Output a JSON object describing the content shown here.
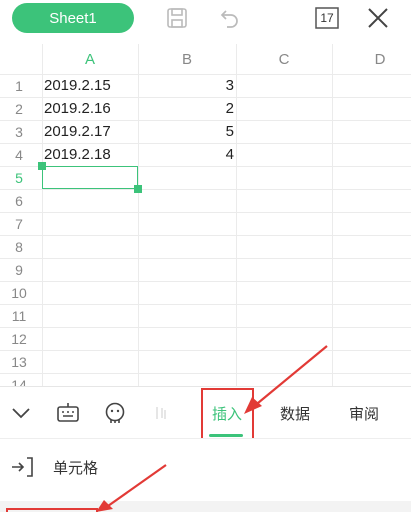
{
  "header": {
    "sheet_tab": "Sheet1",
    "page_count": "17"
  },
  "grid": {
    "columns": [
      "A",
      "B",
      "C",
      "D"
    ],
    "rows": [
      "1",
      "2",
      "3",
      "4",
      "5",
      "6",
      "7",
      "8",
      "9",
      "10",
      "11",
      "12",
      "13",
      "14"
    ],
    "cells": [
      {
        "a": "2019.2.15",
        "b": "3"
      },
      {
        "a": "2019.2.16",
        "b": "2"
      },
      {
        "a": "2019.2.17",
        "b": "5"
      },
      {
        "a": "2019.2.18",
        "b": "4"
      }
    ],
    "active_cell": "A5"
  },
  "toolbar": {
    "tabs": [
      "插入",
      "数据",
      "审阅"
    ],
    "active_tab": "插入"
  },
  "panel": {
    "items": [
      "单元格"
    ]
  },
  "colors": {
    "accent": "#3cc37a",
    "annotation": "#e23a36"
  }
}
